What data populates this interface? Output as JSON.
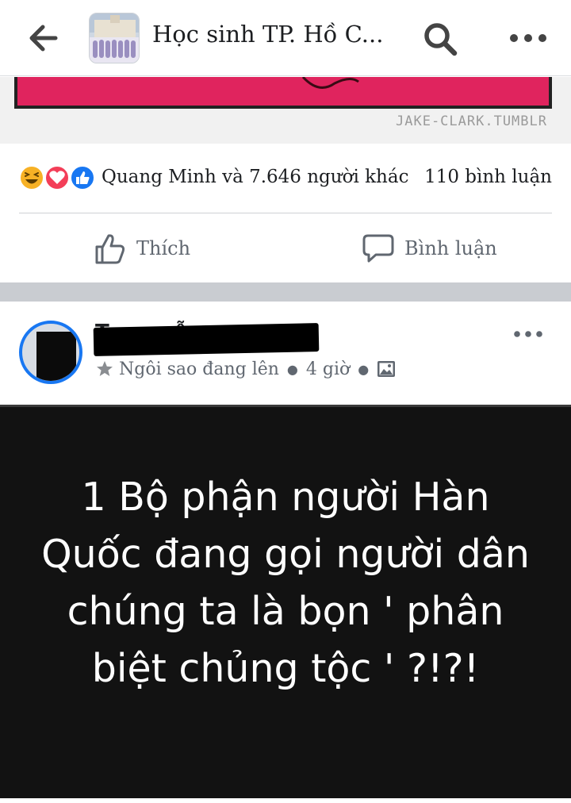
{
  "header": {
    "group_title": "Học sinh TP. Hồ C...",
    "back_icon": "arrow-left-icon",
    "search_icon": "search-icon",
    "more_icon": "more-horizontal-icon"
  },
  "previous_post": {
    "image_watermark": "JAKE-CLARK.TUMBLR",
    "reactions": [
      "haha",
      "love",
      "like"
    ],
    "reactions_text": "Quang Minh và 7.646 người khác",
    "comment_count": "110 bình luận",
    "like_label": "Thích",
    "comment_label": "Bình luận"
  },
  "post": {
    "author_name": "T... ...yễn",
    "badge_label": "Ngôi sao đang lên",
    "time": "4 giờ",
    "image_text": "1 Bộ phận người Hàn Quốc đang gọi người dân chúng ta là bọn ' phân biệt chủng tộc ' ?!?!"
  },
  "colors": {
    "facebook_blue": "#1877f2",
    "love_red": "#f33e58",
    "haha_yellow": "#f7b125",
    "image_bg": "#121212",
    "muted_text": "#606770"
  }
}
